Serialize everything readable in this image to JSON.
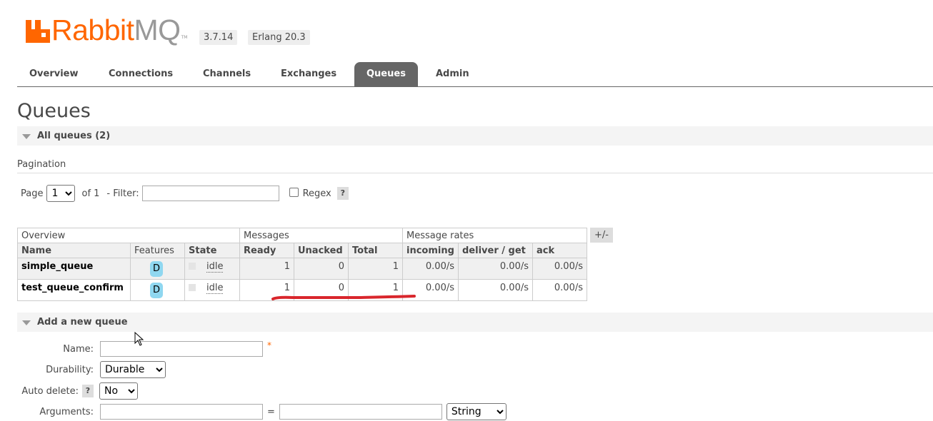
{
  "header": {
    "logo_part1": "Rabbit",
    "logo_part2": "MQ",
    "logo_tm": "TM",
    "version": "3.7.14",
    "erlang": "Erlang 20.3"
  },
  "tabs": [
    {
      "label": "Overview"
    },
    {
      "label": "Connections"
    },
    {
      "label": "Channels"
    },
    {
      "label": "Exchanges"
    },
    {
      "label": "Queues",
      "active": true
    },
    {
      "label": "Admin"
    }
  ],
  "page_title": "Queues",
  "all_queues_label": "All queues (2)",
  "pagination": {
    "label": "Pagination",
    "page_label": "Page",
    "page_value": "1",
    "of_label": "of 1",
    "filter_label": "- Filter:",
    "filter_value": "",
    "regex_label": "Regex",
    "help": "?"
  },
  "table": {
    "group_headers": [
      "Overview",
      "Messages",
      "Message rates"
    ],
    "columns": [
      "Name",
      "Features",
      "State",
      "Ready",
      "Unacked",
      "Total",
      "incoming",
      "deliver / get",
      "ack"
    ],
    "plus_minus": "+/-",
    "rows": [
      {
        "name": "simple_queue",
        "feature": "D",
        "state": "idle",
        "ready": "1",
        "unacked": "0",
        "total": "1",
        "incoming": "0.00/s",
        "deliver": "0.00/s",
        "ack": "0.00/s"
      },
      {
        "name": "test_queue_confirm",
        "feature": "D",
        "state": "idle",
        "ready": "1",
        "unacked": "0",
        "total": "1",
        "incoming": "0.00/s",
        "deliver": "0.00/s",
        "ack": "0.00/s"
      }
    ]
  },
  "add_queue": {
    "section_label": "Add a new queue",
    "name_label": "Name:",
    "name_value": "",
    "required_mark": "*",
    "durability_label": "Durability:",
    "durability_value": "Durable",
    "auto_delete_label": "Auto delete:",
    "auto_delete_help": "?",
    "auto_delete_value": "No",
    "arguments_label": "Arguments:",
    "arguments_eq": "=",
    "arguments_type": "String"
  },
  "colors": {
    "brand": "#ff6600",
    "tab_active": "#666666",
    "feature_badge": "#8fd7f0",
    "annotation_red": "#d9262c"
  }
}
